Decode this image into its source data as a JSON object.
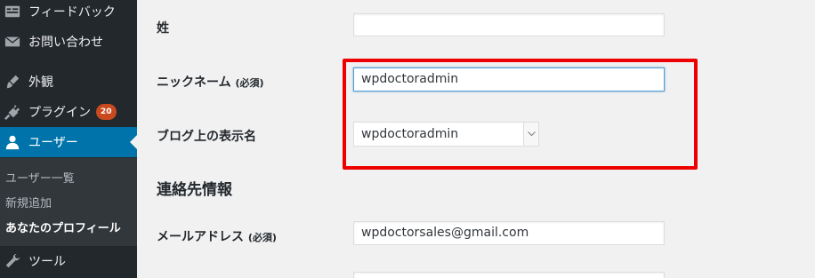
{
  "sidebar": {
    "items": [
      {
        "label": "フィードバック",
        "icon": "feedback-icon"
      },
      {
        "label": "お問い合わせ",
        "icon": "mail-icon"
      },
      {
        "label": "外観",
        "icon": "paintbrush-icon"
      },
      {
        "label": "プラグイン",
        "icon": "plugin-icon",
        "badge": "20"
      },
      {
        "label": "ユーザー",
        "icon": "user-icon",
        "current": true
      },
      {
        "label": "ツール",
        "icon": "wrench-icon"
      }
    ],
    "submenu": [
      {
        "label": "ユーザー一覧"
      },
      {
        "label": "新規追加"
      },
      {
        "label": "あなたのプロフィール",
        "current": true
      }
    ]
  },
  "form": {
    "last_name": {
      "label": "姓",
      "value": ""
    },
    "nickname": {
      "label": "ニックネーム",
      "required": "(必須)",
      "value": "wpdoctoradmin"
    },
    "display_name": {
      "label": "ブログ上の表示名",
      "value": "wpdoctoradmin"
    },
    "contact_section": "連絡先情報",
    "email": {
      "label": "メールアドレス",
      "required": "(必須)",
      "value": "wpdoctorsales@gmail.com"
    }
  },
  "colors": {
    "sidebar_bg": "#23282d",
    "active": "#0073aa",
    "highlight": "#ee0000",
    "badge": "#ca4a1f"
  }
}
